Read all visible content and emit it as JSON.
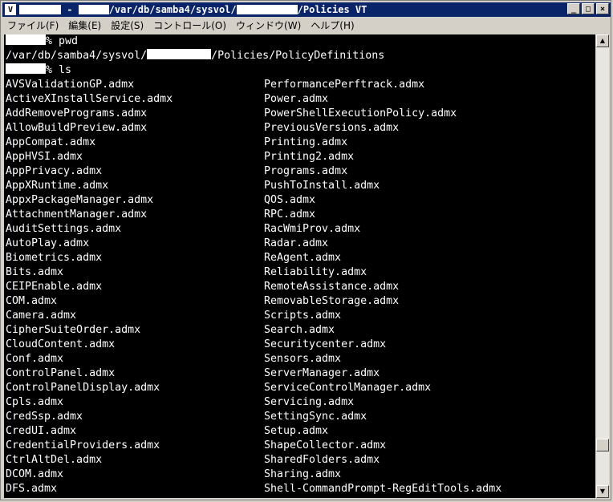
{
  "window": {
    "title_prefix": "/var/db/samba4/sysvol/",
    "title_suffix": "/Policies VT",
    "title_dash": " - ",
    "buttons": {
      "minimize": "_",
      "maximize": "□",
      "close": "×"
    }
  },
  "menu": [
    {
      "label": "ファイル(F)"
    },
    {
      "label": "編集(E)"
    },
    {
      "label": "設定(S)"
    },
    {
      "label": "コントロール(O)"
    },
    {
      "label": "ウィンドウ(W)"
    },
    {
      "label": "ヘルプ(H)"
    }
  ],
  "terminal": {
    "prompt1": "% pwd",
    "path_prefix": "/var/db/samba4/sysvol/",
    "path_suffix": "/Policies/PolicyDefinitions",
    "prompt2": "% ls",
    "files_col1": [
      "AVSValidationGP.admx",
      "ActiveXInstallService.admx",
      "AddRemovePrograms.admx",
      "AllowBuildPreview.admx",
      "AppCompat.admx",
      "AppHVSI.admx",
      "AppPrivacy.admx",
      "AppXRuntime.admx",
      "AppxPackageManager.admx",
      "AttachmentManager.admx",
      "AuditSettings.admx",
      "AutoPlay.admx",
      "Biometrics.admx",
      "Bits.admx",
      "CEIPEnable.admx",
      "COM.admx",
      "Camera.admx",
      "CipherSuiteOrder.admx",
      "CloudContent.admx",
      "Conf.admx",
      "ControlPanel.admx",
      "ControlPanelDisplay.admx",
      "Cpls.admx",
      "CredSsp.admx",
      "CredUI.admx",
      "CredentialProviders.admx",
      "CtrlAltDel.admx",
      "DCOM.admx",
      "DFS.admx"
    ],
    "files_col2": [
      "PerformancePerftrack.admx",
      "Power.admx",
      "PowerShellExecutionPolicy.admx",
      "PreviousVersions.admx",
      "Printing.admx",
      "Printing2.admx",
      "Programs.admx",
      "PushToInstall.admx",
      "QOS.admx",
      "RPC.admx",
      "RacWmiProv.admx",
      "Radar.admx",
      "ReAgent.admx",
      "Reliability.admx",
      "RemoteAssistance.admx",
      "RemovableStorage.admx",
      "Scripts.admx",
      "Search.admx",
      "Securitycenter.admx",
      "Sensors.admx",
      "ServerManager.admx",
      "ServiceControlManager.admx",
      "Servicing.admx",
      "SettingSync.admx",
      "Setup.admx",
      "ShapeCollector.admx",
      "SharedFolders.admx",
      "Sharing.admx",
      "Shell-CommandPrompt-RegEditTools.admx"
    ]
  },
  "scrollbar": {
    "up_icon": "▲",
    "down_icon": "▼",
    "position": 0.92
  }
}
